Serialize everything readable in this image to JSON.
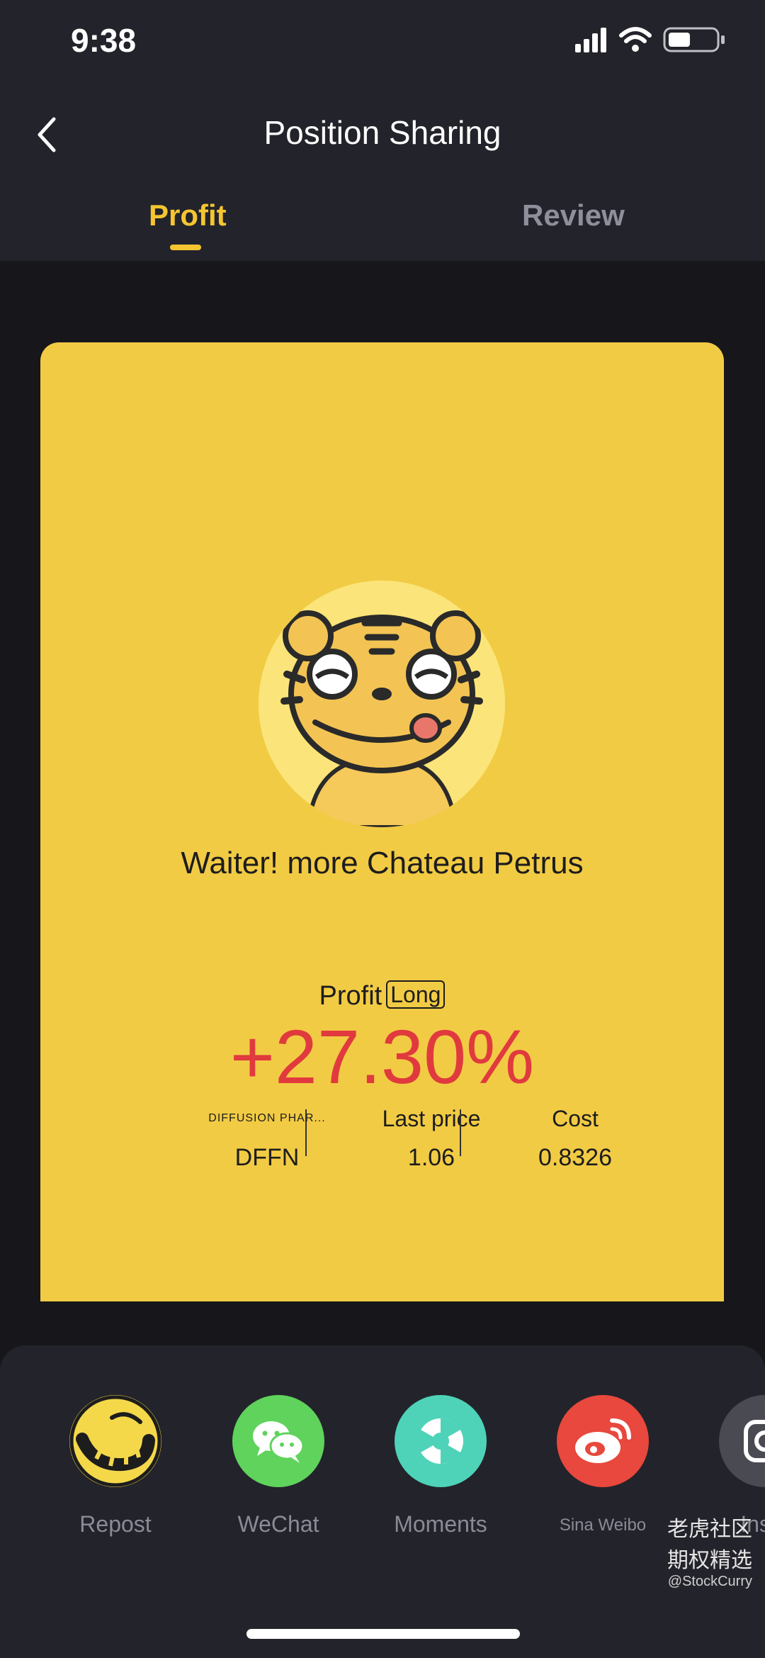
{
  "status_bar": {
    "time": "9:38"
  },
  "header": {
    "title": "Position Sharing"
  },
  "tabs": [
    {
      "label": "Profit",
      "active": true
    },
    {
      "label": "Review",
      "active": false
    }
  ],
  "card": {
    "slogan": "Waiter! more Chateau Petrus",
    "profit_label": "Profit",
    "direction_badge": "Long",
    "profit_value": "+27.30%",
    "stats": [
      {
        "label": "DIFFUSION PHAR...",
        "value": "DFFN"
      },
      {
        "label": "Last price",
        "value": "1.06"
      },
      {
        "label": "Cost",
        "value": "0.8326"
      }
    ]
  },
  "share_targets": [
    {
      "label": "Repost",
      "icon": "tiger-tail-icon",
      "color": "#f4d84a"
    },
    {
      "label": "WeChat",
      "icon": "wechat-icon",
      "color": "#5fd35b"
    },
    {
      "label": "Moments",
      "icon": "moments-icon",
      "color": "#4ed3b8"
    },
    {
      "label": "Sina Weibo",
      "icon": "weibo-icon",
      "color": "#e8483d"
    },
    {
      "label": "Insta",
      "icon": "instagram-icon",
      "color": "#4a4a52"
    }
  ],
  "watermark": {
    "main": "老虎社区",
    "main2": "期权精选",
    "sub": "@StockCurry"
  },
  "colors": {
    "accent": "#f4c531",
    "card": "#f2cb44",
    "profit": "#e03a3e",
    "background": "#16161b",
    "panel": "#23232b"
  }
}
